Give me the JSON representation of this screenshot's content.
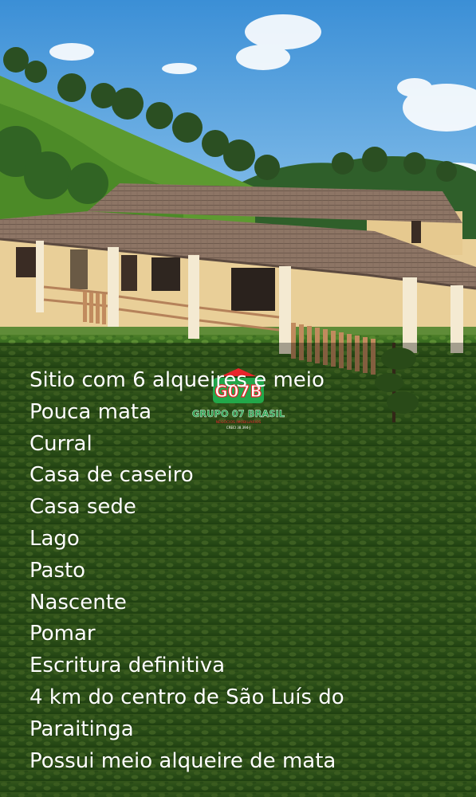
{
  "logo": {
    "mark": "G07B",
    "name": "GRUPO 07 BRASIL",
    "tagline": "NEGÓCIOS IMOBILIÁRIOS",
    "creci": "CRECI 38.394-J",
    "colors": {
      "roof": "#e8242b",
      "mark": "#22a84a",
      "text": "#1fa34a"
    }
  },
  "listing": {
    "lines": [
      "Sitio com 6 alqueires e meio",
      "Pouca mata",
      "Curral",
      "Casa de caseiro",
      "Casa sede",
      "Lago",
      "Pasto",
      "Nascente",
      "Pomar",
      "Escritura definitiva",
      "4 km do centro de São Luís do",
      "Paraitinga",
      "Possui meio alqueire de mata"
    ]
  }
}
